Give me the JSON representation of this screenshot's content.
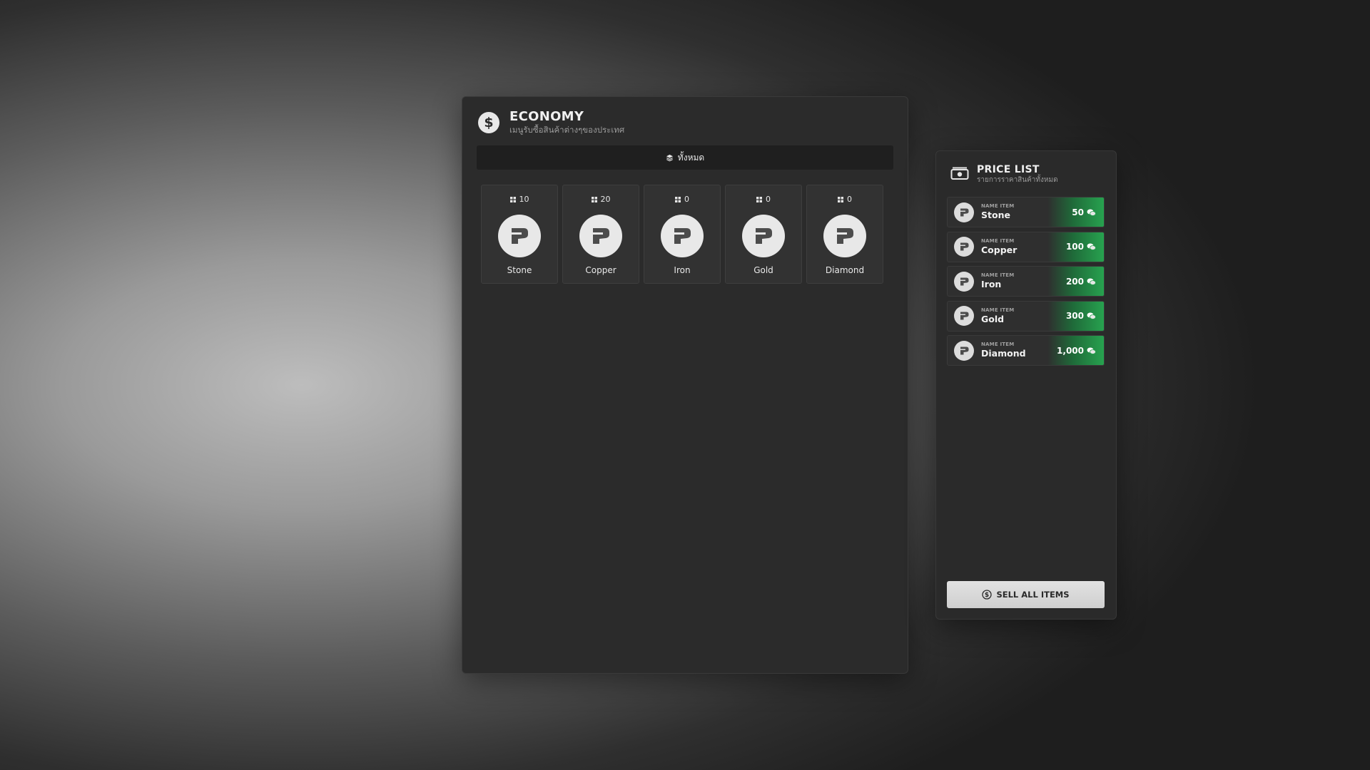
{
  "economy": {
    "title": "ECONOMY",
    "subtitle": "เมนูรับซื้อสินค้าต่างๆของประเทศ",
    "filter_label": "ทั้งหมด",
    "items": [
      {
        "qty": "10",
        "name": "Stone"
      },
      {
        "qty": "20",
        "name": "Copper"
      },
      {
        "qty": "0",
        "name": "Iron"
      },
      {
        "qty": "0",
        "name": "Gold"
      },
      {
        "qty": "0",
        "name": "Diamond"
      }
    ]
  },
  "price_list": {
    "title": "PRICE LIST",
    "subtitle": "รายการราคาสินค้าทั้งหมด",
    "label": "NAME ITEM",
    "items": [
      {
        "name": "Stone",
        "price": "50"
      },
      {
        "name": "Copper",
        "price": "100"
      },
      {
        "name": "Iron",
        "price": "200"
      },
      {
        "name": "Gold",
        "price": "300"
      },
      {
        "name": "Diamond",
        "price": "1,000"
      }
    ],
    "sell_all_label": "SELL ALL ITEMS"
  },
  "icons": {
    "economy": "dollar-icon",
    "filter": "layers-icon",
    "quantity": "grid-icon",
    "item": "question-mark-icon",
    "price_list": "banknote-icon",
    "currency": "coins-icon",
    "sell": "dollar-circle-icon"
  },
  "colors": {
    "accent_green": "#27a24f",
    "panel_bg": "#2b2b2b",
    "button_bg": "#dcdcdc"
  }
}
